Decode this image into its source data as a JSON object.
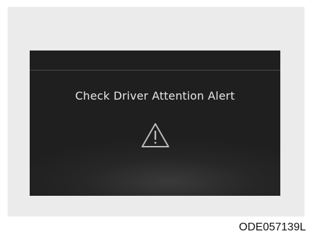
{
  "display": {
    "alert_message": "Check Driver Attention Alert",
    "icon": "warning-triangle-icon"
  },
  "figure": {
    "code": "ODE057139L"
  },
  "colors": {
    "page_background": "#ffffff",
    "panel_background": "#ebebeb",
    "display_background": "#1f1f1f",
    "text": "#e6e6e6"
  }
}
